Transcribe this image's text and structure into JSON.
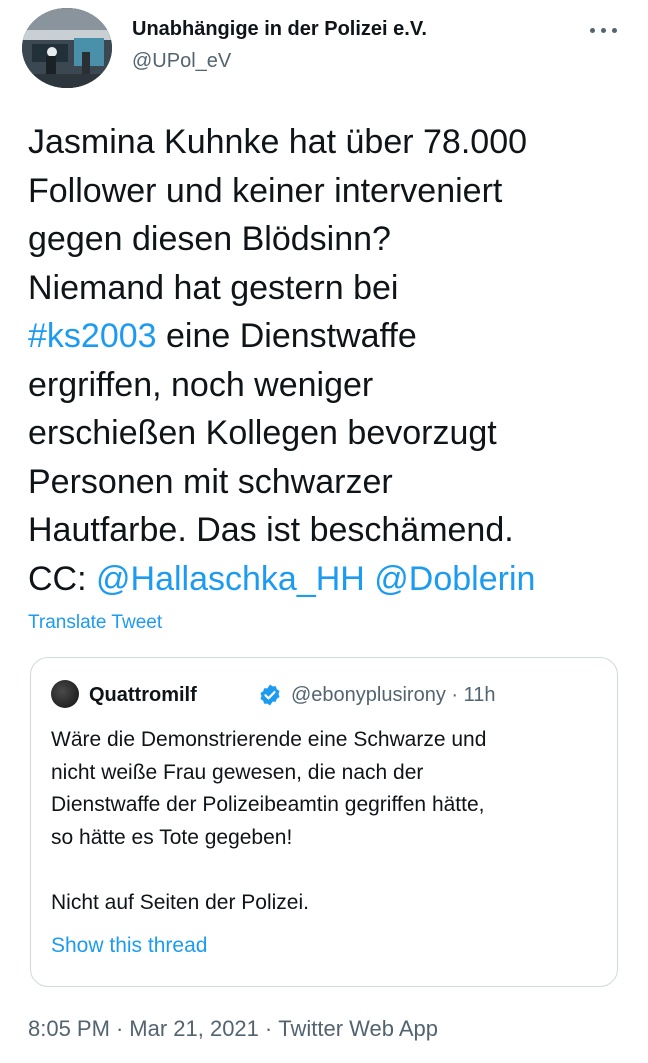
{
  "author": {
    "name": "Unabhängige in der Polizei e.V.",
    "handle": "@UPol_eV"
  },
  "tweet": {
    "lines": [
      [
        {
          "text": "Jasmina Kuhnke hat über 78.000",
          "link": false
        }
      ],
      [
        {
          "text": "Follower und keiner interveniert",
          "link": false
        }
      ],
      [
        {
          "text": "gegen diesen Blödsinn?",
          "link": false
        }
      ],
      [
        {
          "text": "Niemand hat gestern bei",
          "link": false
        }
      ],
      [
        {
          "text": "#ks2003",
          "link": true
        },
        {
          "text": " eine Dienstwaffe",
          "link": false
        }
      ],
      [
        {
          "text": "ergriffen, noch weniger",
          "link": false
        }
      ],
      [
        {
          "text": "erschießen Kollegen bevorzugt",
          "link": false
        }
      ],
      [
        {
          "text": "Personen mit schwarzer",
          "link": false
        }
      ],
      [
        {
          "text": "Hautfarbe. Das ist beschämend.",
          "link": false
        }
      ],
      [
        {
          "text": "CC: ",
          "link": false
        },
        {
          "text": "@Hallaschka_HH",
          "link": true
        },
        {
          "text": " ",
          "link": false
        },
        {
          "text": "@Doblerin",
          "link": true
        }
      ]
    ],
    "translate_label": "Translate Tweet"
  },
  "quote": {
    "name": "Quattromilf",
    "meta": "@ebonyplusirony · 11h",
    "verified_icon": "verified-badge-icon",
    "lines": [
      "Wäre die Demonstrierende eine Schwarze und",
      "nicht weiße Frau gewesen, die nach der",
      "Dienstwaffe der Polizeibeamtin gegriffen hätte,",
      "so hätte es Tote gegeben!",
      "",
      "Nicht auf Seiten der Polizei."
    ],
    "show_thread": "Show this thread"
  },
  "footer": {
    "time": "8:05 PM",
    "separator": "·",
    "date": "Mar 21, 2021",
    "app": "Twitter Web App"
  },
  "colors": {
    "link": "#1d9bf0",
    "text": "#0f1419",
    "secondary": "#536471",
    "border": "#cfd9de"
  }
}
